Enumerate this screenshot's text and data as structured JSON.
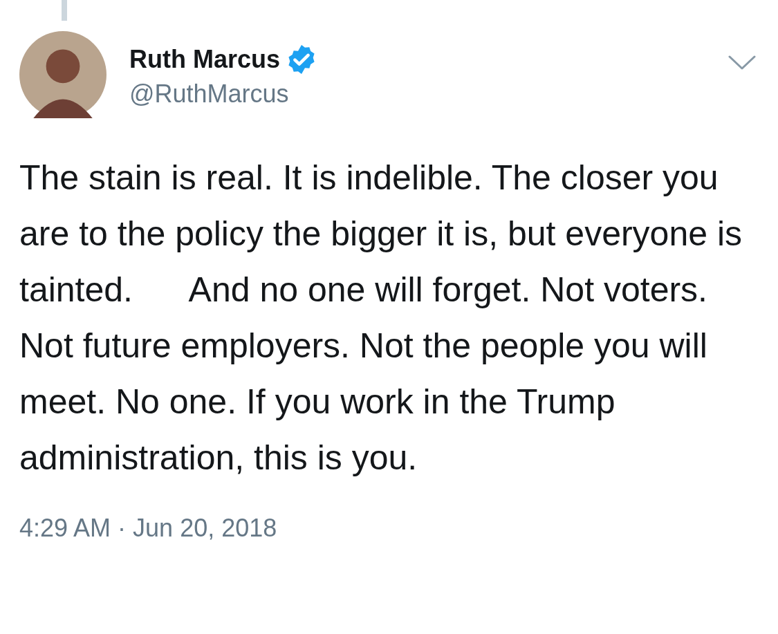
{
  "tweet": {
    "author_name": "Ruth Marcus",
    "verified": true,
    "handle": "@RuthMarcus",
    "text": "The stain is real. It is indelible. The closer you are to the policy the bigger it is, but everyone is tainted.      And no one will forget. Not voters. Not future employers. Not the people you will meet. No one. If you work in the Trump administration, this is you.",
    "time": "4:29 AM",
    "separator": "·",
    "date": "Jun 20, 2018"
  }
}
